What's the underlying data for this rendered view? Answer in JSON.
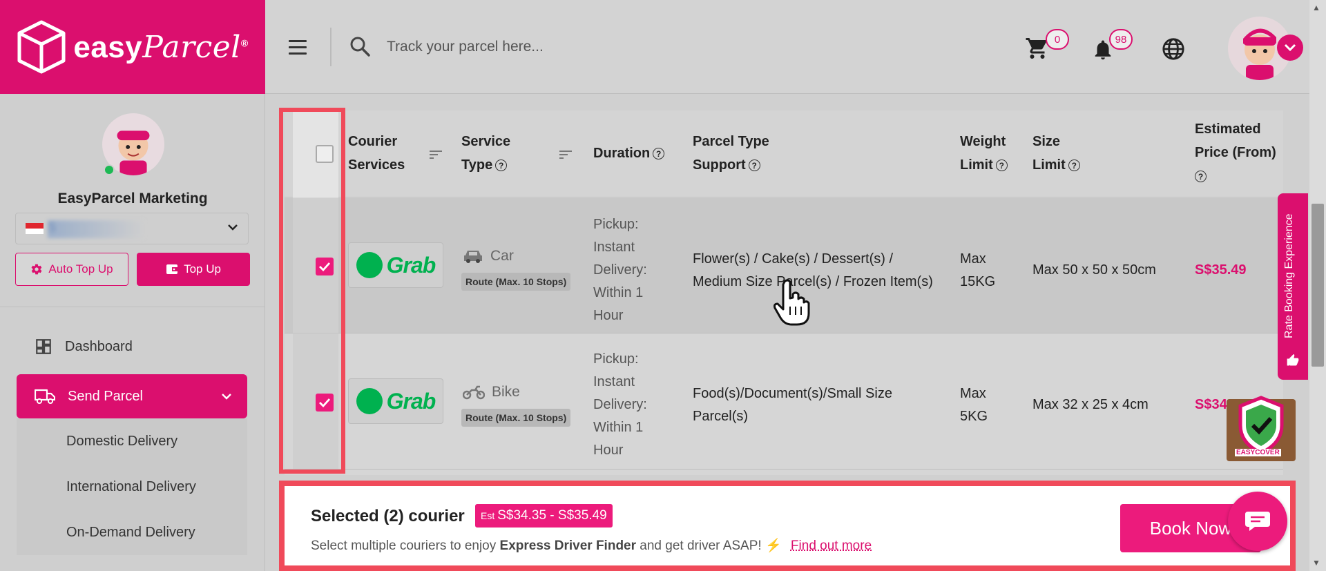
{
  "brand": {
    "name_bold": "easy",
    "name_script": "Parcel",
    "registered": "®",
    "primary_color": "#db0f6e",
    "accent_color": "#ec1b7c",
    "highlight_color": "#f04a5a"
  },
  "header": {
    "search_placeholder": "Track your parcel here...",
    "cart_count": "0",
    "notification_count": "98",
    "icons": [
      "menu-icon",
      "search-icon",
      "cart-icon",
      "bell-icon",
      "globe-icon",
      "chevron-down-icon"
    ]
  },
  "sidebar": {
    "account_name": "EasyParcel Marketing",
    "account_currency": "S",
    "auto_topup_label": "Auto Top Up",
    "topup_label": "Top Up",
    "nav": {
      "dashboard": "Dashboard",
      "send_parcel": "Send Parcel"
    },
    "sub_items": [
      "Domestic Delivery",
      "International Delivery",
      "On-Demand Delivery"
    ]
  },
  "table": {
    "headers": {
      "courier_1": "Courier",
      "courier_2": "Services",
      "service_1": "Service",
      "service_2": "Type",
      "duration": "Duration",
      "parcel_1": "Parcel Type",
      "parcel_2": "Support",
      "weight_1": "Weight",
      "weight_2": "Limit",
      "size_1": "Size",
      "size_2": "Limit",
      "price_1": "Estimated",
      "price_2": "Price (From)"
    },
    "rows": [
      {
        "courier": "Grab",
        "vehicle": "Car",
        "route": "Route (Max. 10 Stops)",
        "duration": [
          "Pickup:",
          "Instant",
          "Delivery:",
          "Within 1",
          "Hour"
        ],
        "parcel_line1": "Flower(s) / Cake(s) / Dessert(s) /",
        "parcel_line2": "Medium Size Parcel(s) / Frozen Item(s)",
        "weight_1": "Max",
        "weight_2": "15KG",
        "size": "Max 50 x 50 x 50cm",
        "price": "S$35.49",
        "checked": true
      },
      {
        "courier": "Grab",
        "vehicle": "Bike",
        "route": "Route (Max. 10 Stops)",
        "duration": [
          "Pickup:",
          "Instant",
          "Delivery:",
          "Within 1",
          "Hour"
        ],
        "parcel_line1": "Food(s)/Document(s)/Small Size",
        "parcel_line2": "Parcel(s)",
        "weight_1": "Max",
        "weight_2": "5KG",
        "size": "Max 32 x 25 x 4cm",
        "price": "S$34.35",
        "checked": true
      }
    ]
  },
  "rate_tab": "Rate Booking Experience",
  "easycover_label": "EASYCOVER",
  "selected_bar": {
    "title": "Selected (2) courier",
    "est_prefix": "Est",
    "est_range": "S$34.35 - S$35.49",
    "desc_before": "Select multiple couriers to enjoy",
    "desc_bold": "Express Driver Finder",
    "desc_after": "and get driver ASAP!",
    "find_out_more": "Find out more",
    "book_now": "Book Now"
  }
}
